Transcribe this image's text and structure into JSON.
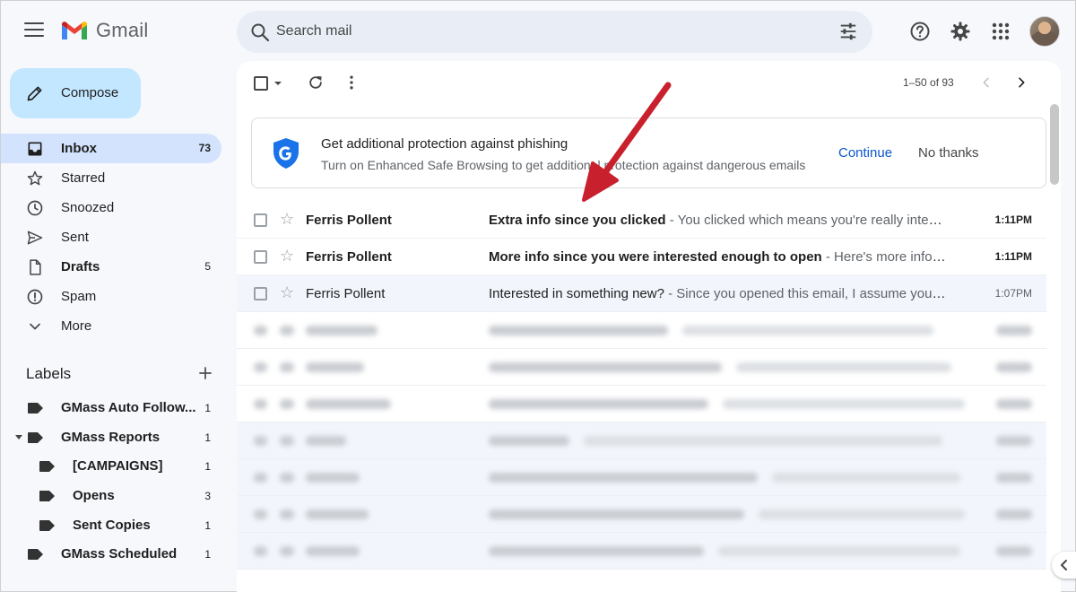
{
  "app": {
    "name": "Gmail"
  },
  "search": {
    "placeholder": "Search mail"
  },
  "compose": {
    "label": "Compose"
  },
  "nav": [
    {
      "label": "Inbox",
      "count": "73",
      "icon": "inbox-icon",
      "active": true,
      "bold": true
    },
    {
      "label": "Starred",
      "count": "",
      "icon": "star-icon"
    },
    {
      "label": "Snoozed",
      "count": "",
      "icon": "clock-icon"
    },
    {
      "label": "Sent",
      "count": "",
      "icon": "send-icon"
    },
    {
      "label": "Drafts",
      "count": "5",
      "icon": "file-icon",
      "bold": true
    },
    {
      "label": "Spam",
      "count": "",
      "icon": "report-icon"
    },
    {
      "label": "More",
      "count": "",
      "icon": "chevron-down-icon"
    }
  ],
  "labels": {
    "heading": "Labels",
    "items": [
      {
        "label": "GMass Auto Follow...",
        "count": "1",
        "nested": false,
        "expanded": false
      },
      {
        "label": "GMass Reports",
        "count": "1",
        "nested": false,
        "expanded": true
      },
      {
        "label": "[CAMPAIGNS]",
        "count": "1",
        "nested": true
      },
      {
        "label": "Opens",
        "count": "3",
        "nested": true
      },
      {
        "label": "Sent Copies",
        "count": "1",
        "nested": true
      },
      {
        "label": "GMass Scheduled",
        "count": "1",
        "nested": false,
        "expanded": false
      }
    ]
  },
  "toolbar": {
    "pager": "1–50 of 93"
  },
  "banner": {
    "title": "Get additional protection against phishing",
    "subtitle": "Turn on Enhanced Safe Browsing to get additional protection against dangerous emails",
    "continue": "Continue",
    "dismiss": "No thanks"
  },
  "emails": [
    {
      "sender": "Ferris Pollent",
      "subject": "Extra info since you clicked",
      "snippet": " - You clicked which means you're really interest...",
      "time": "1:11PM",
      "unread": true
    },
    {
      "sender": "Ferris Pollent",
      "subject": "More info since you were interested enough to open",
      "snippet": " - Here's more info sin...",
      "time": "1:11PM",
      "unread": true
    },
    {
      "sender": "Ferris Pollent",
      "subject": "Interested in something new?",
      "snippet": " - Since you opened this email, I assume you're i...",
      "time": "1:07PM",
      "unread": false
    }
  ],
  "blurred_row_count": 7,
  "colors": {
    "accent": "#0b57d0",
    "compose_bg": "#c2e7ff",
    "active_nav": "#d3e3fd",
    "annotation_arrow": "#c8202c"
  }
}
